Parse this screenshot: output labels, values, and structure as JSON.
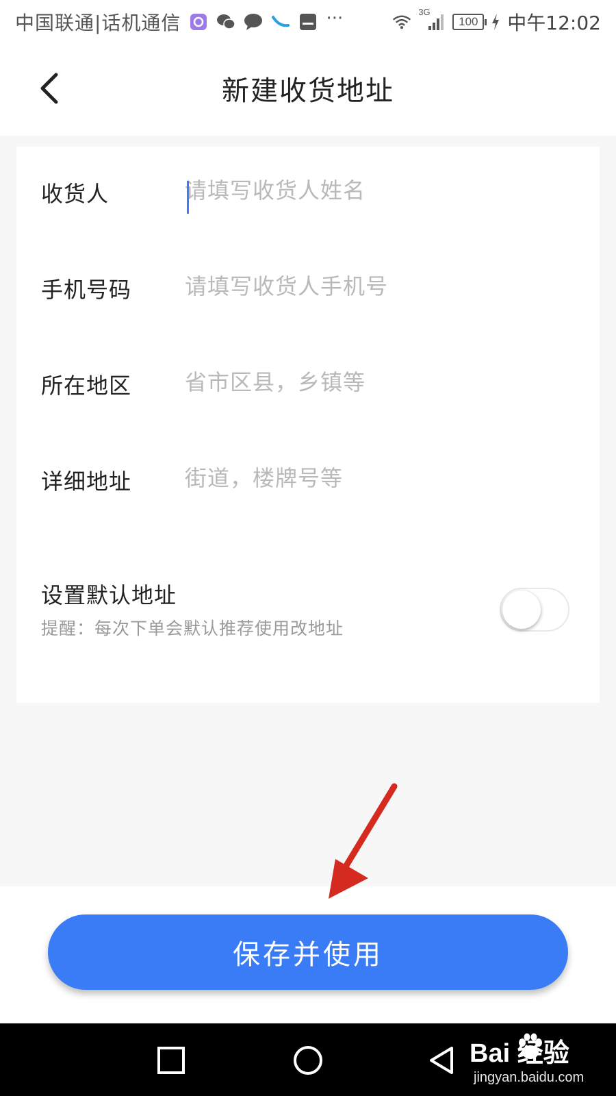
{
  "status_bar": {
    "carrier": "中国联通|话机通信",
    "more": "···",
    "network": "3G",
    "battery": "100",
    "time": "中午12:02",
    "icons": [
      "app-icon",
      "wechat-icon",
      "message-icon",
      "phone-icon",
      "huawei-icon"
    ]
  },
  "header": {
    "title": "新建收货地址"
  },
  "form": {
    "fields": [
      {
        "label": "收货人",
        "placeholder": "请填写收货人姓名",
        "value": ""
      },
      {
        "label": "手机号码",
        "placeholder": "请填写收货人手机号",
        "value": ""
      },
      {
        "label": "所在地区",
        "placeholder": "省市区县，乡镇等",
        "value": ""
      },
      {
        "label": "详细地址",
        "placeholder": "街道，楼牌号等",
        "value": ""
      }
    ],
    "default_address": {
      "label": "设置默认地址",
      "hint": "提醒：每次下单会默认推荐使用改地址",
      "enabled": false
    }
  },
  "actions": {
    "save_label": "保存并使用"
  },
  "watermark": {
    "logo": "Bai  经验",
    "url": "jingyan.baidu.com"
  },
  "colors": {
    "accent": "#3a7bf6",
    "annotation": "#d42a20"
  }
}
